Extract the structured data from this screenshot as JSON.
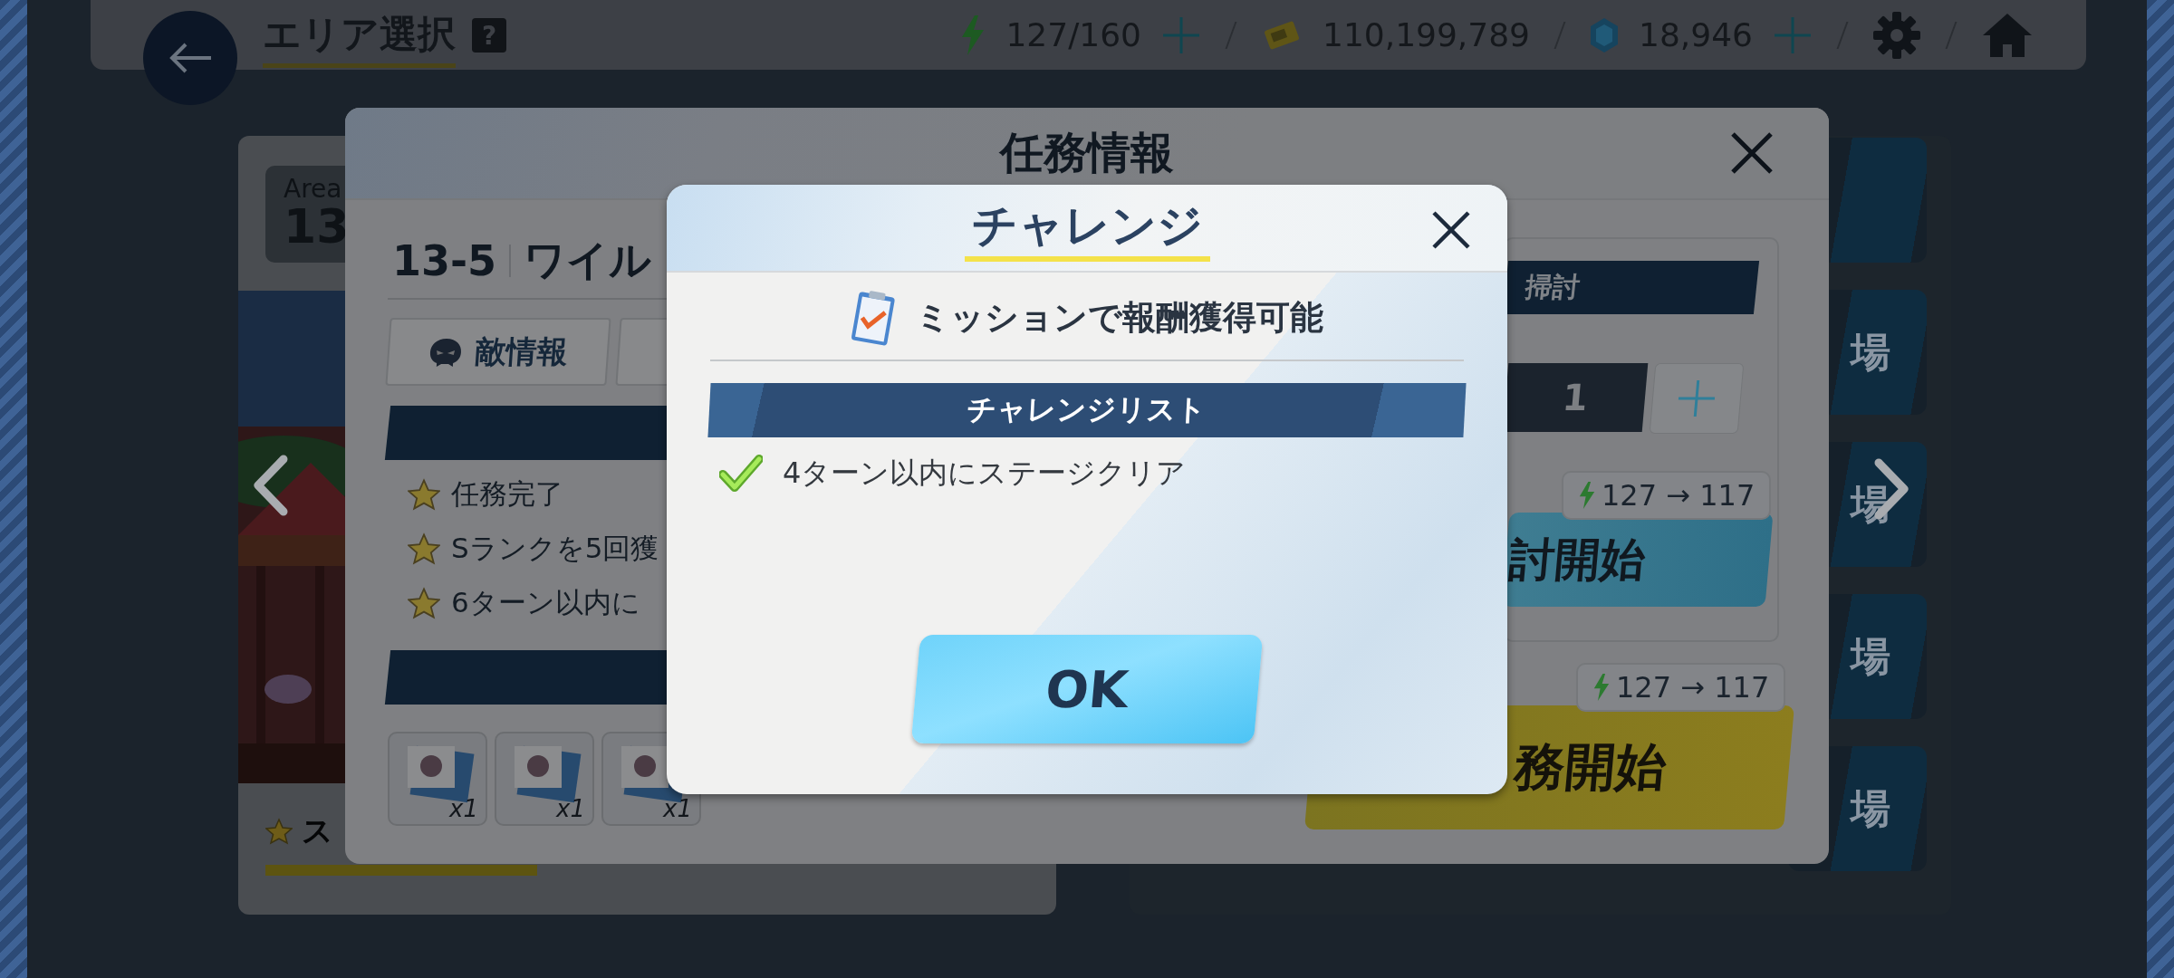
{
  "top_bar": {
    "title": "エリア選択",
    "help": "?",
    "stamina": "127/160",
    "credits": "110,199,789",
    "gems": "18,946"
  },
  "area_card": {
    "label": "Area",
    "number": "13"
  },
  "stage_caption": "ス",
  "side_buttons": [
    "場",
    "場",
    "場",
    "場"
  ],
  "mission": {
    "title": "任務情報",
    "stage_number": "13-5",
    "stage_name": "ワイル",
    "tabs": [
      "敵情報"
    ],
    "objectives": [
      "任務完了",
      "Sランクを5回獲",
      "6ターン以内に"
    ],
    "rewards": [
      "x1",
      "x1",
      "x1"
    ],
    "sweep_label": "掃討",
    "sweep_count": "1",
    "sweep_cost": "127 → 117",
    "sweep_button": "討開始",
    "start_cost": "127 → 117",
    "start_button": "務開始"
  },
  "challenge": {
    "title": "チャレンジ",
    "notice": "ミッションで報酬獲得可能",
    "list_title": "チャレンジリスト",
    "items": [
      {
        "text": "4ターン以内にステージクリア",
        "checked": true
      }
    ],
    "ok": "OK"
  }
}
